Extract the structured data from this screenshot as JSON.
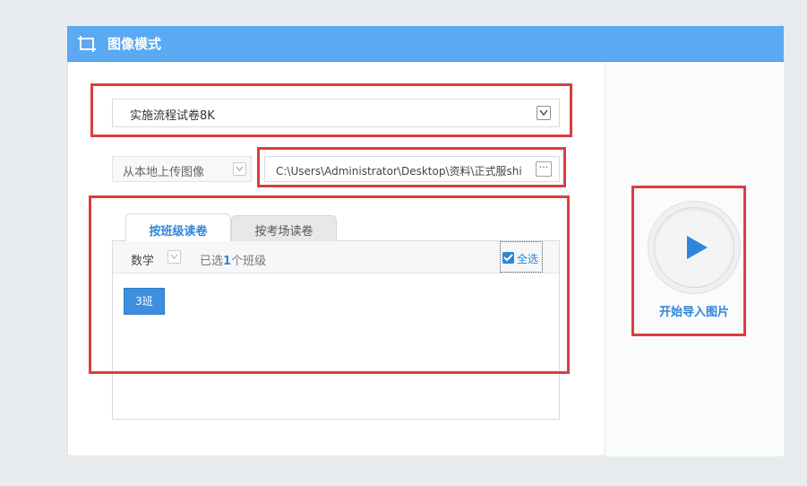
{
  "header": {
    "title": "图像模式",
    "icon": "image-frame-icon"
  },
  "exam_select": {
    "value": "实施流程试卷8K"
  },
  "source_select": {
    "value": "从本地上传图像"
  },
  "path_input": {
    "value": "C:\\Users\\Administrator\\Desktop\\资料\\正式服shi",
    "browse_label": "···"
  },
  "tabs": [
    {
      "label": "按班级读卷",
      "active": true
    },
    {
      "label": "按考场读卷",
      "active": false
    }
  ],
  "filter": {
    "subject": "数学",
    "selected_prefix": "已选",
    "selected_count": "1",
    "selected_suffix": "个班级",
    "select_all_label": "全选",
    "select_all_checked": true
  },
  "classes": [
    {
      "label": "3班",
      "selected": true
    }
  ],
  "start_button": {
    "label": "开始导入图片",
    "icon": "play-icon"
  },
  "colors": {
    "accent": "#2e86d9",
    "header": "#5aa9f2",
    "highlight": "#d93f3f"
  }
}
